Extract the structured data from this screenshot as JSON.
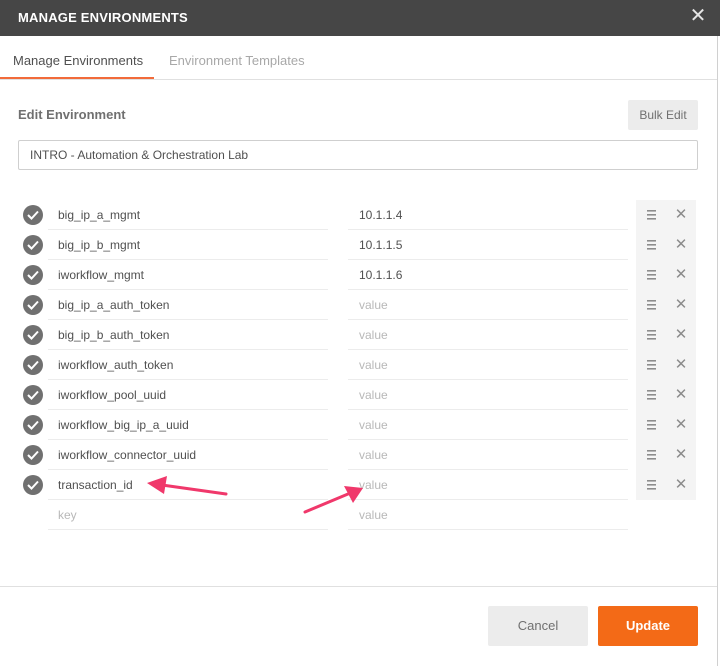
{
  "window": {
    "title": "MANAGE ENVIRONMENTS",
    "close_icon": "close-icon"
  },
  "tabs": [
    {
      "label": "Manage Environments",
      "active": true
    },
    {
      "label": "Environment Templates",
      "active": false
    }
  ],
  "edit": {
    "heading": "Edit Environment",
    "bulk_edit_label": "Bulk Edit",
    "environment_name": "INTRO - Automation & Orchestration Lab"
  },
  "variables": [
    {
      "key": "big_ip_a_mgmt",
      "value": "10.1.1.4",
      "enabled": true
    },
    {
      "key": "big_ip_b_mgmt",
      "value": "10.1.1.5",
      "enabled": true
    },
    {
      "key": "iworkflow_mgmt",
      "value": "10.1.1.6",
      "enabled": true
    },
    {
      "key": "big_ip_a_auth_token",
      "value": "",
      "enabled": true
    },
    {
      "key": "big_ip_b_auth_token",
      "value": "",
      "enabled": true
    },
    {
      "key": "iworkflow_auth_token",
      "value": "",
      "enabled": true
    },
    {
      "key": "iworkflow_pool_uuid",
      "value": "",
      "enabled": true
    },
    {
      "key": "iworkflow_big_ip_a_uuid",
      "value": "",
      "enabled": true
    },
    {
      "key": "iworkflow_connector_uuid",
      "value": "",
      "enabled": true
    },
    {
      "key": "transaction_id",
      "value": "",
      "enabled": true
    }
  ],
  "new_row": {
    "key_placeholder": "key",
    "value_placeholder": "value"
  },
  "value_placeholder": "value",
  "footer": {
    "cancel_label": "Cancel",
    "update_label": "Update"
  },
  "colors": {
    "titlebar": "#464646",
    "accent": "#f26b3a",
    "update_button": "#f36a17",
    "annotation_arrow": "#f0386b"
  }
}
